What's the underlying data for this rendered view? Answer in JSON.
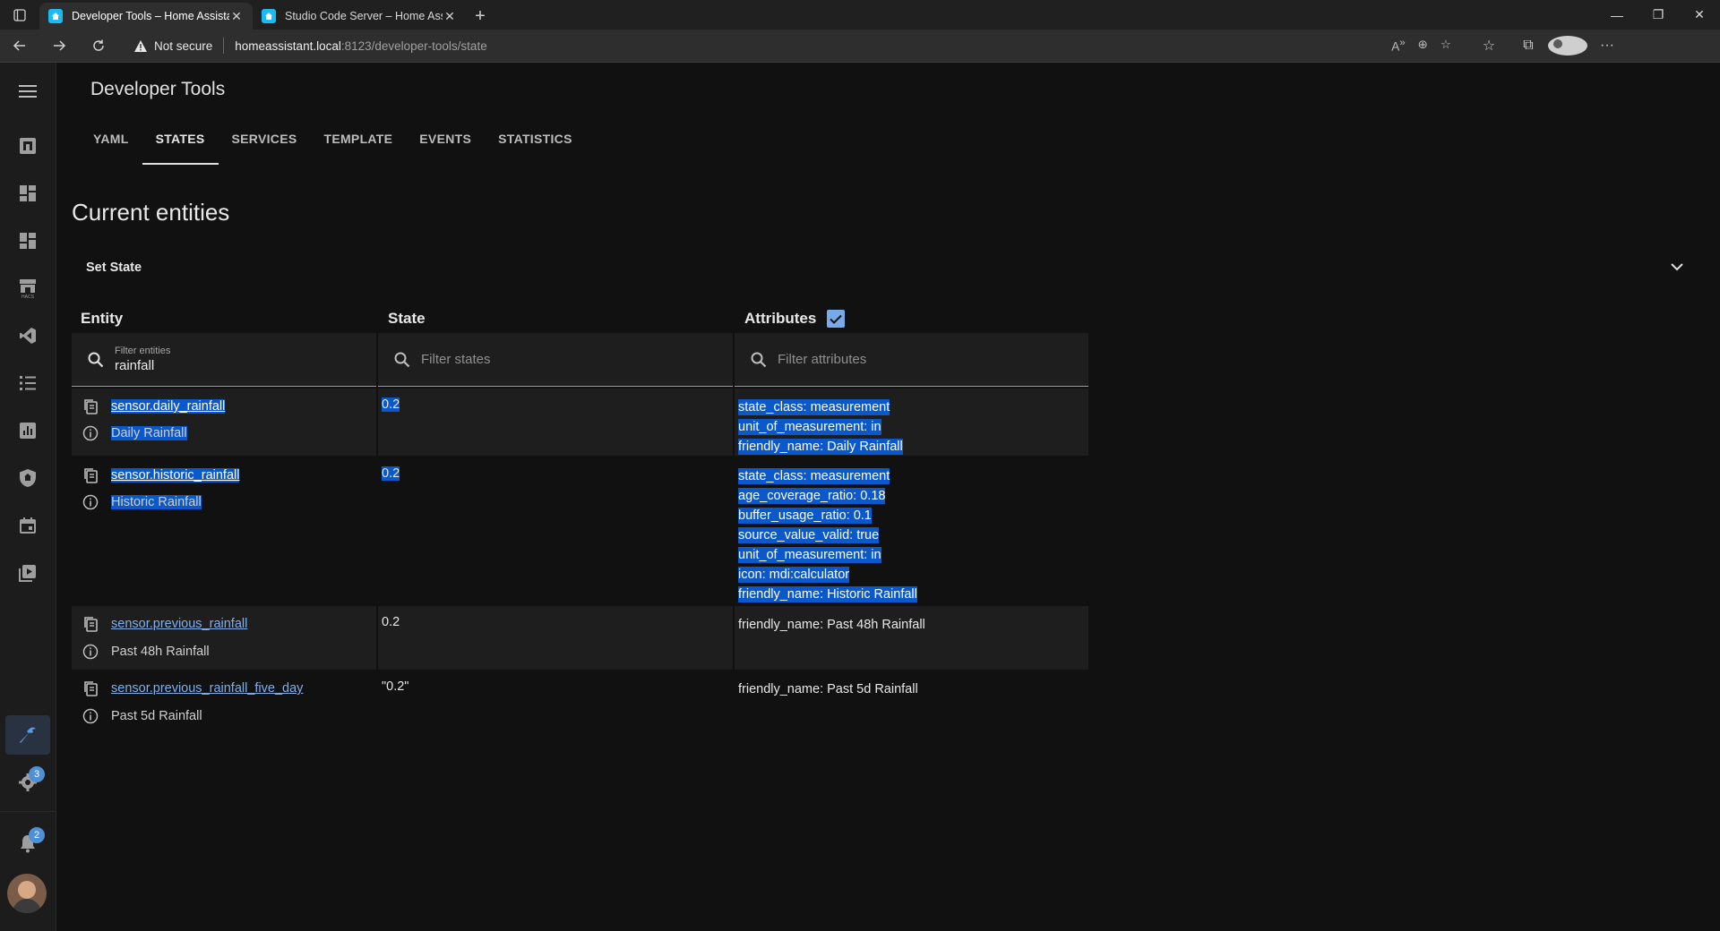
{
  "browser": {
    "tabs": [
      {
        "title": "Developer Tools – Home Assistant",
        "active": true
      },
      {
        "title": "Studio Code Server – Home Assistant",
        "active": false
      }
    ],
    "security_label": "Not secure",
    "url_host": "homeassistant.local",
    "url_path": ":8123/developer-tools/state"
  },
  "sidebar": {
    "items": [
      {
        "name": "menu-icon"
      },
      {
        "name": "overview-icon"
      },
      {
        "name": "dashboard-icon"
      },
      {
        "name": "dashboard-2-icon"
      },
      {
        "name": "hacs-icon"
      },
      {
        "name": "vscode-icon"
      },
      {
        "name": "logbook-icon"
      },
      {
        "name": "history-icon"
      },
      {
        "name": "security-icon"
      },
      {
        "name": "calendar-icon"
      },
      {
        "name": "media-icon"
      },
      {
        "name": "developer-tools-icon",
        "active": true
      },
      {
        "name": "settings-icon",
        "badge": "3"
      },
      {
        "name": "notifications-icon",
        "badge": "2"
      }
    ]
  },
  "header": {
    "title": "Developer Tools",
    "tabs": [
      "YAML",
      "STATES",
      "SERVICES",
      "TEMPLATE",
      "EVENTS",
      "STATISTICS"
    ],
    "active_tab": "STATES"
  },
  "main": {
    "section_title": "Current entities",
    "set_state_label": "Set State",
    "columns": {
      "entity": "Entity",
      "state": "State",
      "attributes": "Attributes"
    },
    "attributes_checked": true,
    "filters": {
      "entity_label": "Filter entities",
      "entity_value": "rainfall",
      "state_placeholder": "Filter states",
      "attr_placeholder": "Filter attributes"
    },
    "rows": [
      {
        "entity_id": "sensor.daily_rainfall",
        "friendly": "Daily Rainfall",
        "state": "0.2",
        "attributes": [
          "state_class: measurement",
          "unit_of_measurement: in",
          "friendly_name: Daily Rainfall"
        ]
      },
      {
        "entity_id": "sensor.historic_rainfall",
        "friendly": "Historic Rainfall",
        "state": "0.2",
        "attributes": [
          "state_class: measurement",
          "age_coverage_ratio: 0.18",
          "buffer_usage_ratio: 0.1",
          "source_value_valid: true",
          "unit_of_measurement: in",
          "icon: mdi:calculator",
          "friendly_name: Historic Rainfall"
        ]
      },
      {
        "entity_id": "sensor.previous_rainfall",
        "friendly": "Past 48h Rainfall",
        "state": "0.2",
        "attributes": [
          "friendly_name: Past 48h Rainfall"
        ]
      },
      {
        "entity_id": "sensor.previous_rainfall_five_day",
        "friendly": "Past 5d Rainfall",
        "state": "\"0.2\"",
        "attributes": [
          "friendly_name: Past 5d Rainfall"
        ]
      }
    ]
  }
}
